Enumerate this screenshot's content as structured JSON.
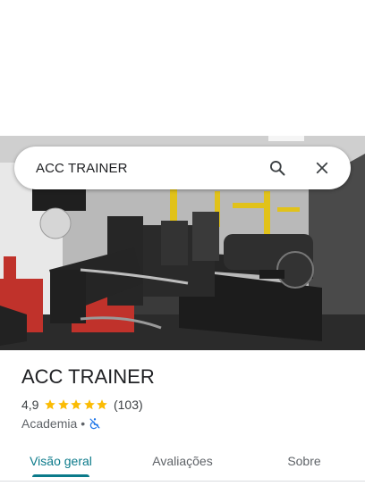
{
  "search": {
    "query": "ACC TRAINER",
    "search_icon": "search-icon",
    "close_icon": "close-icon"
  },
  "place": {
    "name": "ACC TRAINER",
    "rating": "4,9",
    "stars_filled": 5,
    "stars_total": 5,
    "review_count": "(103)",
    "category": "Academia",
    "separator": "•",
    "accessibility_icon": "not-wheelchair-accessible-icon"
  },
  "tabs": [
    {
      "label": "Visão geral",
      "active": true
    },
    {
      "label": "Avaliações",
      "active": false
    },
    {
      "label": "Sobre",
      "active": false
    }
  ],
  "colors": {
    "accent": "#0b7a8a",
    "star": "#fbbc04",
    "text_primary": "#202124",
    "text_secondary": "#5f6368"
  }
}
